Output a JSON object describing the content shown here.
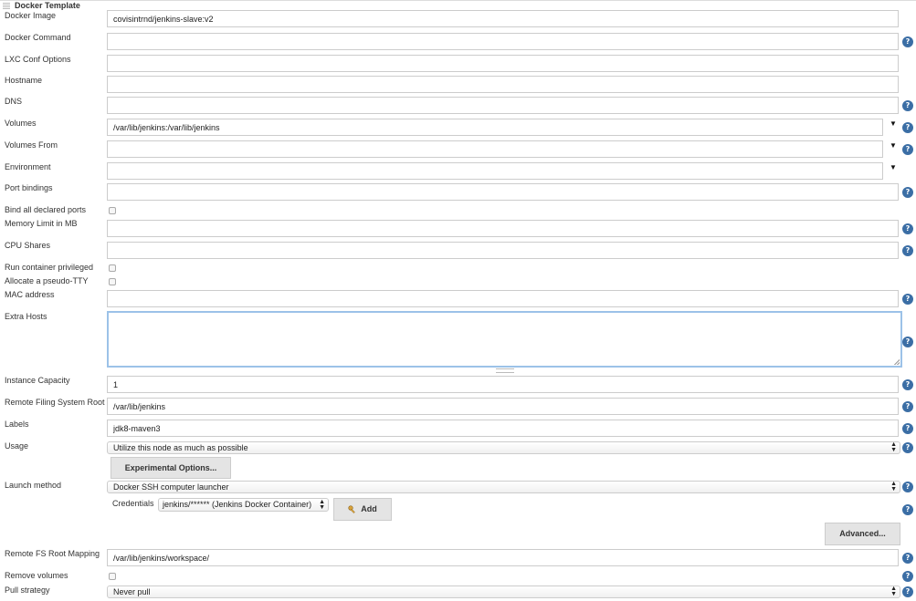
{
  "section": {
    "title": "Docker Template"
  },
  "fields": {
    "docker_image": {
      "label": "Docker Image",
      "value": "covisintrnd/jenkins-slave:v2"
    },
    "docker_command": {
      "label": "Docker Command",
      "value": ""
    },
    "lxc_conf": {
      "label": "LXC Conf Options",
      "value": ""
    },
    "hostname": {
      "label": "Hostname",
      "value": ""
    },
    "dns": {
      "label": "DNS",
      "value": ""
    },
    "volumes": {
      "label": "Volumes",
      "value": "/var/lib/jenkins:/var/lib/jenkins"
    },
    "volumes_from": {
      "label": "Volumes From",
      "value": ""
    },
    "environment": {
      "label": "Environment",
      "value": ""
    },
    "port_bindings": {
      "label": "Port bindings",
      "value": ""
    },
    "bind_all_ports": {
      "label": "Bind all declared ports",
      "checked": false
    },
    "memory_limit": {
      "label": "Memory Limit in MB",
      "value": ""
    },
    "cpu_shares": {
      "label": "CPU Shares",
      "value": ""
    },
    "run_privileged": {
      "label": "Run container privileged",
      "checked": false
    },
    "pseudo_tty": {
      "label": "Allocate a pseudo-TTY",
      "checked": false
    },
    "mac_address": {
      "label": "MAC address",
      "value": ""
    },
    "extra_hosts": {
      "label": "Extra Hosts",
      "value": ""
    },
    "instance_capacity": {
      "label": "Instance Capacity",
      "value": "1"
    },
    "remote_fs_root": {
      "label": "Remote Filing System Root",
      "value": "/var/lib/jenkins"
    },
    "labels": {
      "label": "Labels",
      "value": "jdk8-maven3"
    },
    "usage": {
      "label": "Usage",
      "value": "Utilize this node as much as possible"
    },
    "launch_method": {
      "label": "Launch method",
      "value": "Docker SSH computer launcher"
    },
    "credentials": {
      "label": "Credentials",
      "value": "jenkins/****** (Jenkins Docker Container)"
    },
    "remote_fs_mapping": {
      "label": "Remote FS Root Mapping",
      "value": "/var/lib/jenkins/workspace/"
    },
    "remove_volumes": {
      "label": "Remove volumes",
      "checked": false
    },
    "pull_strategy": {
      "label": "Pull strategy",
      "value": "Never pull"
    }
  },
  "buttons": {
    "experimental": "Experimental Options...",
    "add": "Add",
    "advanced": "Advanced..."
  },
  "help_glyph": "?",
  "combo_arrow": "▼",
  "colors": {
    "help_icon": "#3b6ea5",
    "focus_border": "#9cc2e8",
    "button_bg": "#e4e4e4"
  }
}
